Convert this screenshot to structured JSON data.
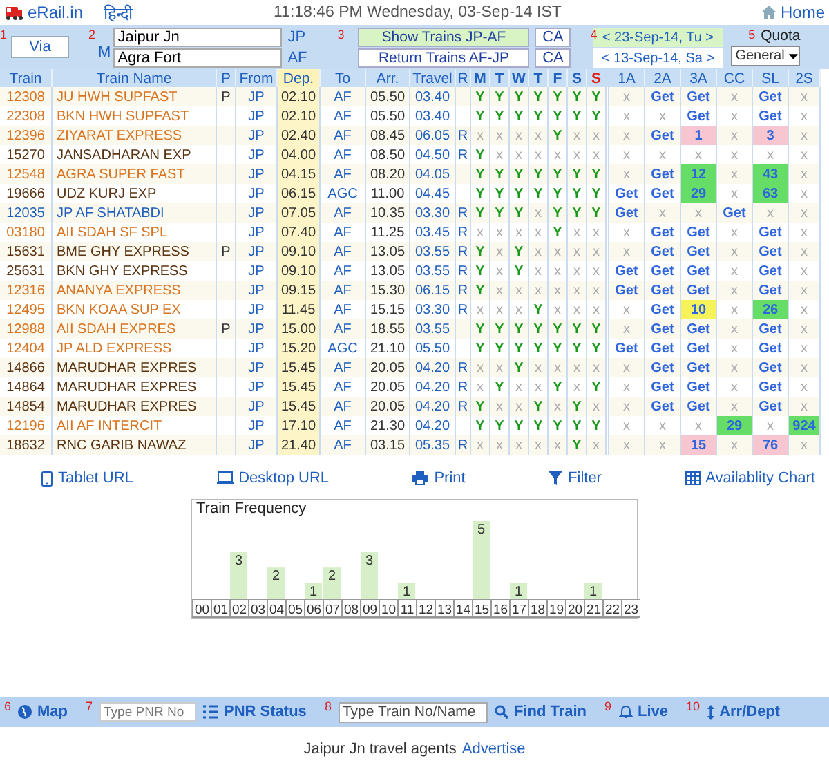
{
  "header": {
    "logo": "eRail.in",
    "language_link": "हिन्दी",
    "datetime": "11:18:46 PM Wednesday, 03-Sep-14 IST",
    "home": "Home"
  },
  "search_form": {
    "via_step": "1",
    "via_button": "Via",
    "station_step": "2",
    "mode": "M",
    "from_station": "Jaipur Jn",
    "from_code": "JP",
    "to_station": "Agra Fort",
    "to_code": "AF",
    "trains_step": "3",
    "train_buttons": [
      {
        "label": "Show Trains JP-AF",
        "selected": true
      },
      {
        "label": "Return Trains AF-JP",
        "selected": false
      }
    ],
    "class_buttons": [
      "CA",
      "CA"
    ],
    "date_step": "4",
    "dates": [
      {
        "label": "< 23-Sep-14, Tu >",
        "selected": true
      },
      {
        "label": "< 13-Sep-14, Sa >",
        "selected": false
      }
    ],
    "quota_step": "5",
    "quota_label": "Quota",
    "quota": "General"
  },
  "table": {
    "columns": [
      "Train",
      "Train Name",
      "P",
      "From",
      "Dep.",
      "To",
      "Arr.",
      "Travel",
      "R"
    ],
    "days": [
      {
        "label": "M",
        "color": "#1f5fbf"
      },
      {
        "label": "T",
        "color": "#1f5fbf"
      },
      {
        "label": "W",
        "color": "#1f5fbf"
      },
      {
        "label": "T",
        "color": "#1f5fbf"
      },
      {
        "label": "F",
        "color": "#1f5fbf"
      },
      {
        "label": "S",
        "color": "#1f5fbf"
      },
      {
        "label": "S",
        "color": "#e0201a"
      }
    ],
    "classes": [
      "1A",
      "2A",
      "3A",
      "CC",
      "SL",
      "2S"
    ],
    "rows": [
      {
        "number": "12308",
        "name": "JU HWH SUPFAST",
        "color": "#d9731f",
        "p": "P",
        "from": "JP",
        "dep": "02.10",
        "to": "AF",
        "arr": "05.50",
        "travel": "03.40",
        "days": [
          {
            "t": "Y",
            "on": true
          },
          {
            "t": "Y",
            "on": true
          },
          {
            "t": "Y",
            "on": true
          },
          {
            "t": "Y",
            "on": true
          },
          {
            "t": "Y",
            "on": true
          },
          {
            "t": "Y",
            "on": true
          },
          {
            "t": "Y",
            "on": true
          }
        ],
        "avail": [
          {
            "t": "x",
            "kind": "none"
          },
          {
            "t": "Get",
            "kind": "link"
          },
          {
            "t": "Get",
            "kind": "link"
          },
          {
            "t": "x",
            "kind": "none"
          },
          {
            "t": "Get",
            "kind": "link"
          },
          {
            "t": "x",
            "kind": "none"
          }
        ]
      },
      {
        "number": "22308",
        "name": "BKN HWH SUPFAST",
        "color": "#d9731f",
        "from": "JP",
        "dep": "02.10",
        "to": "AF",
        "arr": "05.50",
        "travel": "03.40",
        "days": [
          {
            "t": "Y",
            "on": true
          },
          {
            "t": "Y",
            "on": true
          },
          {
            "t": "Y",
            "on": true
          },
          {
            "t": "Y",
            "on": true
          },
          {
            "t": "Y",
            "on": true
          },
          {
            "t": "Y",
            "on": true
          },
          {
            "t": "Y",
            "on": true
          }
        ],
        "avail": [
          {
            "t": "x",
            "kind": "none"
          },
          {
            "t": "x",
            "kind": "none"
          },
          {
            "t": "Get",
            "kind": "link"
          },
          {
            "t": "x",
            "kind": "none"
          },
          {
            "t": "Get",
            "kind": "link"
          },
          {
            "t": "x",
            "kind": "none"
          }
        ]
      },
      {
        "number": "12396",
        "name": "ZIYARAT EXPRESS",
        "color": "#d9731f",
        "from": "JP",
        "dep": "02.40",
        "to": "AF",
        "arr": "08.45",
        "travel": "06.05",
        "r": "R",
        "days": [
          {
            "t": "x",
            "on": false
          },
          {
            "t": "x",
            "on": false
          },
          {
            "t": "x",
            "on": false
          },
          {
            "t": "x",
            "on": false
          },
          {
            "t": "Y",
            "on": true
          },
          {
            "t": "x",
            "on": false
          },
          {
            "t": "x",
            "on": false
          }
        ],
        "avail": [
          {
            "t": "x",
            "kind": "none"
          },
          {
            "t": "Get",
            "kind": "link"
          },
          {
            "t": "1",
            "kind": "seats",
            "color": "#f7c6d0"
          },
          {
            "t": "x",
            "kind": "none"
          },
          {
            "t": "3",
            "kind": "seats",
            "color": "#f7c6d0"
          },
          {
            "t": "x",
            "kind": "none"
          }
        ]
      },
      {
        "number": "15270",
        "name": "JANSADHARAN EXP",
        "color": "#5a3412",
        "from": "JP",
        "dep": "04.00",
        "to": "AF",
        "arr": "08.50",
        "travel": "04.50",
        "r": "R",
        "days": [
          {
            "t": "Y",
            "on": true
          },
          {
            "t": "x",
            "on": false
          },
          {
            "t": "x",
            "on": false
          },
          {
            "t": "x",
            "on": false
          },
          {
            "t": "x",
            "on": false
          },
          {
            "t": "x",
            "on": false
          },
          {
            "t": "x",
            "on": false
          }
        ],
        "avail": [
          {
            "t": "x",
            "kind": "none"
          },
          {
            "t": "x",
            "kind": "none"
          },
          {
            "t": "x",
            "kind": "none"
          },
          {
            "t": "x",
            "kind": "none"
          },
          {
            "t": "x",
            "kind": "none"
          },
          {
            "t": "x",
            "kind": "none"
          }
        ]
      },
      {
        "number": "12548",
        "name": "AGRA SUPER FAST",
        "color": "#d9731f",
        "from": "JP",
        "dep": "04.15",
        "to": "AF",
        "arr": "08.20",
        "travel": "04.05",
        "days": [
          {
            "t": "Y",
            "on": true
          },
          {
            "t": "Y",
            "on": true
          },
          {
            "t": "Y",
            "on": true
          },
          {
            "t": "Y",
            "on": true
          },
          {
            "t": "Y",
            "on": true
          },
          {
            "t": "Y",
            "on": true
          },
          {
            "t": "Y",
            "on": true
          }
        ],
        "avail": [
          {
            "t": "x",
            "kind": "none"
          },
          {
            "t": "Get",
            "kind": "link"
          },
          {
            "t": "12",
            "kind": "seats",
            "color": "#66dd66"
          },
          {
            "t": "x",
            "kind": "none"
          },
          {
            "t": "43",
            "kind": "seats",
            "color": "#66dd66"
          },
          {
            "t": "x",
            "kind": "none"
          }
        ]
      },
      {
        "number": "19666",
        "name": "UDZ KURJ EXP",
        "color": "#5a3412",
        "from": "JP",
        "dep": "06.15",
        "to": "AGC",
        "arr": "11.00",
        "travel": "04.45",
        "days": [
          {
            "t": "Y",
            "on": true
          },
          {
            "t": "Y",
            "on": true
          },
          {
            "t": "Y",
            "on": true
          },
          {
            "t": "Y",
            "on": true
          },
          {
            "t": "Y",
            "on": true
          },
          {
            "t": "Y",
            "on": true
          },
          {
            "t": "Y",
            "on": true
          }
        ],
        "avail": [
          {
            "t": "Get",
            "kind": "link"
          },
          {
            "t": "Get",
            "kind": "link"
          },
          {
            "t": "29",
            "kind": "seats",
            "color": "#66dd66"
          },
          {
            "t": "x",
            "kind": "none"
          },
          {
            "t": "63",
            "kind": "seats",
            "color": "#66dd66"
          },
          {
            "t": "x",
            "kind": "none"
          }
        ]
      },
      {
        "number": "12035",
        "name": "JP AF SHATABDI",
        "color": "#1f5fbf",
        "from": "JP",
        "dep": "07.05",
        "to": "AF",
        "arr": "10.35",
        "travel": "03.30",
        "r": "R",
        "days": [
          {
            "t": "Y",
            "on": true
          },
          {
            "t": "Y",
            "on": true
          },
          {
            "t": "Y",
            "on": true
          },
          {
            "t": "x",
            "on": false
          },
          {
            "t": "Y",
            "on": true
          },
          {
            "t": "Y",
            "on": true
          },
          {
            "t": "Y",
            "on": true
          }
        ],
        "avail": [
          {
            "t": "Get",
            "kind": "link"
          },
          {
            "t": "x",
            "kind": "none"
          },
          {
            "t": "x",
            "kind": "none"
          },
          {
            "t": "Get",
            "kind": "link"
          },
          {
            "t": "x",
            "kind": "none"
          },
          {
            "t": "x",
            "kind": "none"
          }
        ]
      },
      {
        "number": "03180",
        "name": "AII SDAH SF SPL",
        "color": "#d9731f",
        "from": "JP",
        "dep": "07.40",
        "to": "AF",
        "arr": "11.25",
        "travel": "03.45",
        "r": "R",
        "days": [
          {
            "t": "x",
            "on": false
          },
          {
            "t": "x",
            "on": false
          },
          {
            "t": "x",
            "on": false
          },
          {
            "t": "x",
            "on": false
          },
          {
            "t": "Y",
            "on": true
          },
          {
            "t": "x",
            "on": false
          },
          {
            "t": "x",
            "on": false
          }
        ],
        "avail": [
          {
            "t": "x",
            "kind": "none"
          },
          {
            "t": "Get",
            "kind": "link"
          },
          {
            "t": "Get",
            "kind": "link"
          },
          {
            "t": "x",
            "kind": "none"
          },
          {
            "t": "Get",
            "kind": "link"
          },
          {
            "t": "x",
            "kind": "none"
          }
        ]
      },
      {
        "number": "15631",
        "name": "BME GHY EXPRESS",
        "color": "#5a3412",
        "p": "P",
        "from": "JP",
        "dep": "09.10",
        "to": "AF",
        "arr": "13.05",
        "travel": "03.55",
        "r": "R",
        "days": [
          {
            "t": "Y",
            "on": true
          },
          {
            "t": "x",
            "on": false
          },
          {
            "t": "Y",
            "on": true
          },
          {
            "t": "x",
            "on": false
          },
          {
            "t": "x",
            "on": false
          },
          {
            "t": "x",
            "on": false
          },
          {
            "t": "x",
            "on": false
          }
        ],
        "avail": [
          {
            "t": "x",
            "kind": "none"
          },
          {
            "t": "Get",
            "kind": "link"
          },
          {
            "t": "Get",
            "kind": "link"
          },
          {
            "t": "x",
            "kind": "none"
          },
          {
            "t": "Get",
            "kind": "link"
          },
          {
            "t": "x",
            "kind": "none"
          }
        ]
      },
      {
        "number": "25631",
        "name": "BKN GHY EXPRESS",
        "color": "#5a3412",
        "from": "JP",
        "dep": "09.10",
        "to": "AF",
        "arr": "13.05",
        "travel": "03.55",
        "r": "R",
        "days": [
          {
            "t": "Y",
            "on": true
          },
          {
            "t": "x",
            "on": false
          },
          {
            "t": "Y",
            "on": true
          },
          {
            "t": "x",
            "on": false
          },
          {
            "t": "x",
            "on": false
          },
          {
            "t": "x",
            "on": false
          },
          {
            "t": "x",
            "on": false
          }
        ],
        "avail": [
          {
            "t": "Get",
            "kind": "link"
          },
          {
            "t": "Get",
            "kind": "link"
          },
          {
            "t": "Get",
            "kind": "link"
          },
          {
            "t": "x",
            "kind": "none"
          },
          {
            "t": "Get",
            "kind": "link"
          },
          {
            "t": "x",
            "kind": "none"
          }
        ]
      },
      {
        "number": "12316",
        "name": "ANANYA EXPRESS",
        "color": "#d9731f",
        "from": "JP",
        "dep": "09.15",
        "to": "AF",
        "arr": "15.30",
        "travel": "06.15",
        "r": "R",
        "days": [
          {
            "t": "Y",
            "on": true
          },
          {
            "t": "x",
            "on": false
          },
          {
            "t": "x",
            "on": false
          },
          {
            "t": "x",
            "on": false
          },
          {
            "t": "x",
            "on": false
          },
          {
            "t": "x",
            "on": false
          },
          {
            "t": "x",
            "on": false
          }
        ],
        "avail": [
          {
            "t": "Get",
            "kind": "link"
          },
          {
            "t": "Get",
            "kind": "link"
          },
          {
            "t": "Get",
            "kind": "link"
          },
          {
            "t": "x",
            "kind": "none"
          },
          {
            "t": "Get",
            "kind": "link"
          },
          {
            "t": "x",
            "kind": "none"
          }
        ]
      },
      {
        "number": "12495",
        "name": "BKN KOAA SUP EX",
        "color": "#d9731f",
        "from": "JP",
        "dep": "11.45",
        "to": "AF",
        "arr": "15.15",
        "travel": "03.30",
        "r": "R",
        "days": [
          {
            "t": "x",
            "on": false
          },
          {
            "t": "x",
            "on": false
          },
          {
            "t": "x",
            "on": false
          },
          {
            "t": "Y",
            "on": true
          },
          {
            "t": "x",
            "on": false
          },
          {
            "t": "x",
            "on": false
          },
          {
            "t": "x",
            "on": false
          }
        ],
        "avail": [
          {
            "t": "x",
            "kind": "none"
          },
          {
            "t": "Get",
            "kind": "link"
          },
          {
            "t": "10",
            "kind": "seats",
            "color": "#f5f25a"
          },
          {
            "t": "x",
            "kind": "none"
          },
          {
            "t": "26",
            "kind": "seats",
            "color": "#66dd66"
          },
          {
            "t": "x",
            "kind": "none"
          }
        ]
      },
      {
        "number": "12988",
        "name": "AII SDAH EXPRES",
        "color": "#d9731f",
        "p": "P",
        "from": "JP",
        "dep": "15.00",
        "to": "AF",
        "arr": "18.55",
        "travel": "03.55",
        "days": [
          {
            "t": "Y",
            "on": true
          },
          {
            "t": "Y",
            "on": true
          },
          {
            "t": "Y",
            "on": true
          },
          {
            "t": "Y",
            "on": true
          },
          {
            "t": "Y",
            "on": true
          },
          {
            "t": "Y",
            "on": true
          },
          {
            "t": "Y",
            "on": true
          }
        ],
        "avail": [
          {
            "t": "x",
            "kind": "none"
          },
          {
            "t": "Get",
            "kind": "link"
          },
          {
            "t": "Get",
            "kind": "link"
          },
          {
            "t": "x",
            "kind": "none"
          },
          {
            "t": "Get",
            "kind": "link"
          },
          {
            "t": "x",
            "kind": "none"
          }
        ]
      },
      {
        "number": "12404",
        "name": "JP ALD EXPRESS",
        "color": "#d9731f",
        "from": "JP",
        "dep": "15.20",
        "to": "AGC",
        "arr": "21.10",
        "travel": "05.50",
        "days": [
          {
            "t": "Y",
            "on": true
          },
          {
            "t": "Y",
            "on": true
          },
          {
            "t": "Y",
            "on": true
          },
          {
            "t": "Y",
            "on": true
          },
          {
            "t": "Y",
            "on": true
          },
          {
            "t": "Y",
            "on": true
          },
          {
            "t": "Y",
            "on": true
          }
        ],
        "avail": [
          {
            "t": "Get",
            "kind": "link"
          },
          {
            "t": "Get",
            "kind": "link"
          },
          {
            "t": "Get",
            "kind": "link"
          },
          {
            "t": "x",
            "kind": "none"
          },
          {
            "t": "Get",
            "kind": "link"
          },
          {
            "t": "x",
            "kind": "none"
          }
        ]
      },
      {
        "number": "14866",
        "name": "MARUDHAR EXPRES",
        "color": "#5a3412",
        "from": "JP",
        "dep": "15.45",
        "to": "AF",
        "arr": "20.05",
        "travel": "04.20",
        "r": "R",
        "days": [
          {
            "t": "x",
            "on": false
          },
          {
            "t": "x",
            "on": false
          },
          {
            "t": "Y",
            "on": true
          },
          {
            "t": "x",
            "on": false
          },
          {
            "t": "x",
            "on": false
          },
          {
            "t": "x",
            "on": false
          },
          {
            "t": "x",
            "on": false
          }
        ],
        "avail": [
          {
            "t": "x",
            "kind": "none"
          },
          {
            "t": "Get",
            "kind": "link"
          },
          {
            "t": "Get",
            "kind": "link"
          },
          {
            "t": "x",
            "kind": "none"
          },
          {
            "t": "Get",
            "kind": "link"
          },
          {
            "t": "x",
            "kind": "none"
          }
        ]
      },
      {
        "number": "14864",
        "name": "MARUDHAR EXPRES",
        "color": "#5a3412",
        "from": "JP",
        "dep": "15.45",
        "to": "AF",
        "arr": "20.05",
        "travel": "04.20",
        "r": "R",
        "days": [
          {
            "t": "x",
            "on": false
          },
          {
            "t": "Y",
            "on": true
          },
          {
            "t": "x",
            "on": false
          },
          {
            "t": "x",
            "on": false
          },
          {
            "t": "Y",
            "on": true
          },
          {
            "t": "x",
            "on": false
          },
          {
            "t": "Y",
            "on": true
          }
        ],
        "avail": [
          {
            "t": "x",
            "kind": "none"
          },
          {
            "t": "Get",
            "kind": "link"
          },
          {
            "t": "Get",
            "kind": "link"
          },
          {
            "t": "x",
            "kind": "none"
          },
          {
            "t": "Get",
            "kind": "link"
          },
          {
            "t": "x",
            "kind": "none"
          }
        ]
      },
      {
        "number": "14854",
        "name": "MARUDHAR EXPRES",
        "color": "#5a3412",
        "from": "JP",
        "dep": "15.45",
        "to": "AF",
        "arr": "20.05",
        "travel": "04.20",
        "r": "R",
        "days": [
          {
            "t": "Y",
            "on": true
          },
          {
            "t": "x",
            "on": false
          },
          {
            "t": "x",
            "on": false
          },
          {
            "t": "Y",
            "on": true
          },
          {
            "t": "x",
            "on": false
          },
          {
            "t": "Y",
            "on": true
          },
          {
            "t": "x",
            "on": false
          }
        ],
        "avail": [
          {
            "t": "x",
            "kind": "none"
          },
          {
            "t": "Get",
            "kind": "link"
          },
          {
            "t": "Get",
            "kind": "link"
          },
          {
            "t": "x",
            "kind": "none"
          },
          {
            "t": "Get",
            "kind": "link"
          },
          {
            "t": "x",
            "kind": "none"
          }
        ]
      },
      {
        "number": "12196",
        "name": "AII AF INTERCIT",
        "color": "#d9731f",
        "from": "JP",
        "dep": "17.10",
        "to": "AF",
        "arr": "21.30",
        "travel": "04.20",
        "days": [
          {
            "t": "Y",
            "on": true
          },
          {
            "t": "Y",
            "on": true
          },
          {
            "t": "Y",
            "on": true
          },
          {
            "t": "Y",
            "on": true
          },
          {
            "t": "Y",
            "on": true
          },
          {
            "t": "Y",
            "on": true
          },
          {
            "t": "Y",
            "on": true
          }
        ],
        "avail": [
          {
            "t": "x",
            "kind": "none"
          },
          {
            "t": "x",
            "kind": "none"
          },
          {
            "t": "x",
            "kind": "none"
          },
          {
            "t": "29",
            "kind": "seats",
            "color": "#66dd66"
          },
          {
            "t": "x",
            "kind": "none"
          },
          {
            "t": "924",
            "kind": "seats",
            "color": "#66dd66"
          }
        ]
      },
      {
        "number": "18632",
        "name": "RNC GARIB NAWAZ",
        "color": "#5a3412",
        "from": "JP",
        "dep": "21.40",
        "to": "AF",
        "arr": "03.15",
        "travel": "05.35",
        "r": "R",
        "days": [
          {
            "t": "x",
            "on": false
          },
          {
            "t": "x",
            "on": false
          },
          {
            "t": "x",
            "on": false
          },
          {
            "t": "x",
            "on": false
          },
          {
            "t": "x",
            "on": false
          },
          {
            "t": "Y",
            "on": true
          },
          {
            "t": "x",
            "on": false
          }
        ],
        "avail": [
          {
            "t": "x",
            "kind": "none"
          },
          {
            "t": "x",
            "kind": "none"
          },
          {
            "t": "15",
            "kind": "seats",
            "color": "#f7c6d0"
          },
          {
            "t": "x",
            "kind": "none"
          },
          {
            "t": "76",
            "kind": "seats",
            "color": "#f7c6d0"
          },
          {
            "t": "x",
            "kind": "none"
          }
        ]
      }
    ]
  },
  "links": [
    {
      "label": "Tablet URL",
      "kind": "tablet"
    },
    {
      "label": "Desktop URL",
      "kind": "desktop"
    },
    {
      "label": "Print",
      "kind": "print"
    },
    {
      "label": "Filter",
      "kind": "filter"
    },
    {
      "label": "Availablity Chart",
      "kind": "grid"
    }
  ],
  "frequency": {
    "chart_data": {
      "type": "bar",
      "title": "Train Frequency",
      "categories": [
        "00",
        "01",
        "02",
        "03",
        "04",
        "05",
        "06",
        "07",
        "08",
        "09",
        "10",
        "11",
        "12",
        "13",
        "14",
        "15",
        "16",
        "17",
        "18",
        "19",
        "20",
        "21",
        "22",
        "23"
      ],
      "values": [
        0,
        0,
        3,
        0,
        2,
        0,
        1,
        2,
        0,
        3,
        0,
        1,
        0,
        0,
        0,
        5,
        0,
        1,
        0,
        0,
        0,
        1,
        0,
        0
      ],
      "value_labels": [
        null,
        null,
        "3",
        null,
        "2",
        null,
        "1",
        "2",
        null,
        "3",
        null,
        "1",
        null,
        null,
        null,
        "5",
        null,
        "1",
        null,
        null,
        null,
        "1",
        null,
        null
      ]
    }
  },
  "bottom_bar": {
    "map_step": "6",
    "map": "Map",
    "pnr_step": "7",
    "pnr_placeholder": "Type PNR No",
    "pnr_status": "PNR Status",
    "train_step": "8",
    "train_value": "Type Train No/Name",
    "find_train": "Find Train",
    "live_step": "9",
    "live": "Live",
    "arrdept_step": "10",
    "arrdept": "Arr/Dept"
  },
  "footer": {
    "text": "Jaipur Jn travel agents",
    "link": "Advertise"
  }
}
